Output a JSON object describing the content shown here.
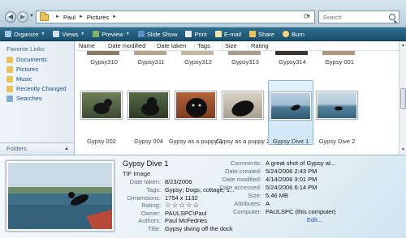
{
  "address": {
    "crumbs": [
      "Paul",
      "Pictures"
    ],
    "search_placeholder": "Search"
  },
  "toolbar": {
    "organize": "Organize",
    "views": "Views",
    "preview": "Preview",
    "slideshow": "Slide Show",
    "print": "Print",
    "email": "E-mail",
    "share": "Share",
    "burn": "Burn"
  },
  "sidebar": {
    "title": "Favorite Links",
    "items": [
      {
        "label": "Documents",
        "icon": "documents-icon"
      },
      {
        "label": "Pictures",
        "icon": "pictures-icon"
      },
      {
        "label": "Music",
        "icon": "music-icon"
      },
      {
        "label": "Recently Changed",
        "icon": "recently-changed-icon"
      },
      {
        "label": "Searches",
        "icon": "searches-icon"
      }
    ],
    "folders_label": "Folders"
  },
  "columns": [
    "Name",
    "Date modified",
    "Date taken",
    "Tags",
    "Size",
    "Rating"
  ],
  "files_top": [
    "Gypsy310",
    "Gypsy311",
    "Gypsy312",
    "Gypsy313",
    "Gypsy314",
    "Gypsy 001"
  ],
  "files": [
    {
      "name": "Gypsy 002",
      "selected": false
    },
    {
      "name": "Gypsy 004",
      "selected": false
    },
    {
      "name": "Gypsy as a puppy 1",
      "selected": false
    },
    {
      "name": "Gypsy as a puppy 2",
      "selected": false
    },
    {
      "name": "Gypsy Dive 1",
      "selected": true
    },
    {
      "name": "Gypsy Dive 2",
      "selected": false
    }
  ],
  "details": {
    "title": "Gypsy Dive 1",
    "type": "TIF Image",
    "left_fields": [
      {
        "key": "Date taken:",
        "value": "8/23/2006"
      },
      {
        "key": "Tags:",
        "value": "Gypsy; Dogs; cottage; s..."
      },
      {
        "key": "Dimensions:",
        "value": "1754 x 1132"
      },
      {
        "key": "Rating:",
        "value": "☆☆☆☆☆"
      },
      {
        "key": "Owner:",
        "value": "PAULSPC\\Paul"
      },
      {
        "key": "Authors:",
        "value": "Paul McFedries"
      },
      {
        "key": "Title:",
        "value": "Gypsy diving off the dock"
      }
    ],
    "right_fields": [
      {
        "key": "Comments:",
        "value": "A great shot of Gypsy at..."
      },
      {
        "key": "Date created:",
        "value": "5/24/2006 2:43 PM"
      },
      {
        "key": "Date modified:",
        "value": "4/14/2006 3:01 PM"
      },
      {
        "key": "Date accessed:",
        "value": "5/24/2006 6:14 PM"
      },
      {
        "key": "Size:",
        "value": "5.46 MB"
      },
      {
        "key": "Attributes:",
        "value": "A"
      },
      {
        "key": "Computer:",
        "value": "PAULSPC (this computer)"
      }
    ],
    "edit_link": "Edit..."
  }
}
